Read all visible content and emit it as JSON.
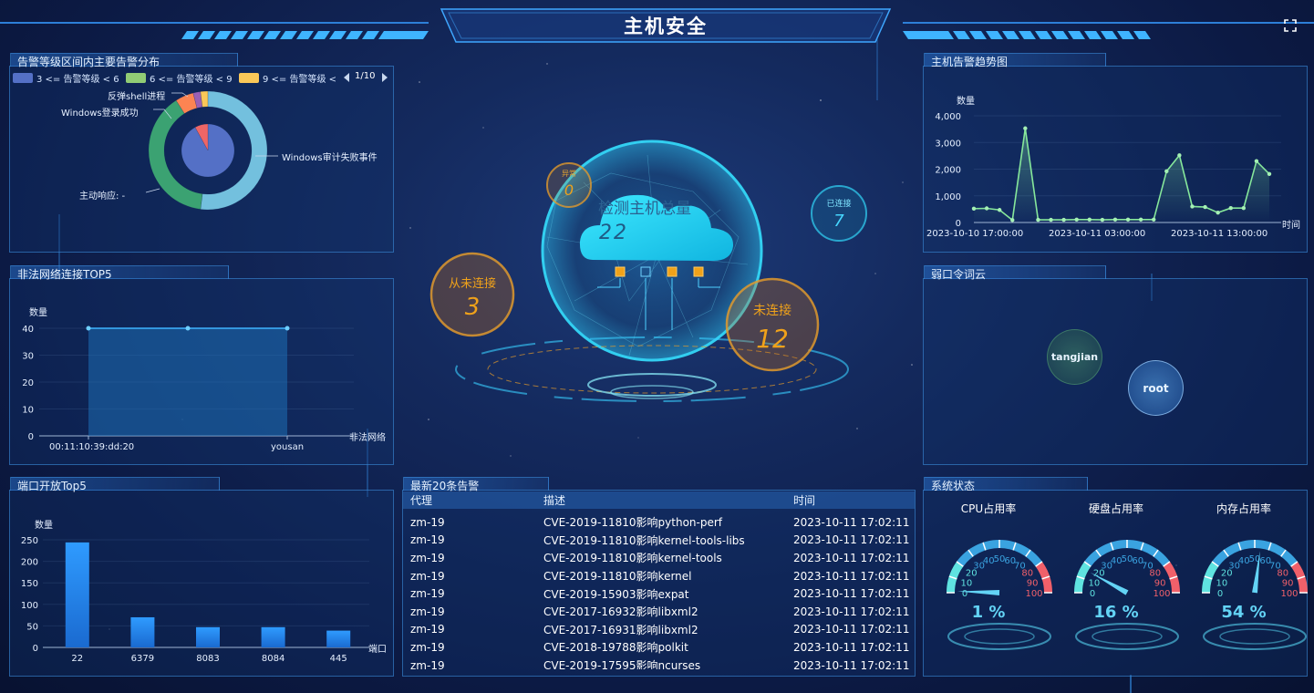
{
  "header": {
    "title": "主机安全",
    "fullscreen_icon": "fullscreen-icon"
  },
  "alarm_dist": {
    "title": "告警等级区间内主要告警分布",
    "legend": [
      {
        "label": "3 <= 告警等级 < 6",
        "color": "#5470c6"
      },
      {
        "label": "6 <= 告警等级 < 9",
        "color": "#91cc75"
      },
      {
        "label": "9 <= 告警等级 <",
        "color": "#fac858"
      }
    ],
    "pager": "1/10",
    "labels": {
      "shell": "反弹shell进程",
      "win_login": "Windows登录成功",
      "win_audit": "Windows审计失败事件",
      "active": "主动响应: -"
    }
  },
  "illegal_conn": {
    "title": "非法网络连接TOP5",
    "y_name": "数量",
    "x_name": "非法网络",
    "x_labels": [
      "00:11:10:39:dd:20",
      "yousan"
    ]
  },
  "port_open": {
    "title": "端口开放Top5",
    "y_name": "数量",
    "x_name": "端口"
  },
  "center": {
    "total_label": "检测主机总量",
    "total_value": "22",
    "abnormal_label": "异常",
    "abnormal_value": "0",
    "connected_label": "已连接",
    "connected_value": "7",
    "never_label": "从未连接",
    "never_value": "3",
    "disconnected_label": "未连接",
    "disconnected_value": "12"
  },
  "trend": {
    "title": "主机告警趋势图",
    "y_name": "数量",
    "x_name": "时间",
    "x_labels": [
      "2023-10-10 17:00:00",
      "2023-10-11 03:00:00",
      "2023-10-11 13:00:00"
    ]
  },
  "weak_pwd": {
    "title": "弱口令词云",
    "words": [
      "tangjian",
      "root"
    ]
  },
  "alerts": {
    "title": "最新20条告警",
    "headers": [
      "代理",
      "描述",
      "时间"
    ],
    "rows": [
      [
        "zm-19",
        "CVE-2019-11810影响python-perf",
        "2023-10-11 17:02:11"
      ],
      [
        "zm-19",
        "CVE-2019-11810影响kernel-tools-libs",
        "2023-10-11 17:02:11"
      ],
      [
        "zm-19",
        "CVE-2019-11810影响kernel-tools",
        "2023-10-11 17:02:11"
      ],
      [
        "zm-19",
        "CVE-2019-11810影响kernel",
        "2023-10-11 17:02:11"
      ],
      [
        "zm-19",
        "CVE-2019-15903影响expat",
        "2023-10-11 17:02:11"
      ],
      [
        "zm-19",
        "CVE-2017-16932影响libxml2",
        "2023-10-11 17:02:11"
      ],
      [
        "zm-19",
        "CVE-2017-16931影响libxml2",
        "2023-10-11 17:02:11"
      ],
      [
        "zm-19",
        "CVE-2018-19788影响polkit",
        "2023-10-11 17:02:11"
      ],
      [
        "zm-19",
        "CVE-2019-17595影响ncurses",
        "2023-10-11 17:02:11"
      ]
    ]
  },
  "system": {
    "title": "系统状态",
    "gauges": [
      {
        "label": "CPU占用率",
        "value": 1,
        "display": "1 %"
      },
      {
        "label": "硬盘占用率",
        "value": 16,
        "display": "16 %"
      },
      {
        "label": "内存占用率",
        "value": 54,
        "display": "54 %"
      }
    ],
    "ticks": [
      "0",
      "10",
      "20",
      "30",
      "40",
      "50",
      "60",
      "70",
      "80",
      "90",
      "100"
    ]
  },
  "chart_data": [
    {
      "type": "pie",
      "title": "告警等级区间内主要告警分布",
      "series": [
        {
          "name": "inner",
          "values": [
            {
              "label": "",
              "value": 92,
              "color": "#5470c6"
            },
            {
              "label": "",
              "value": 8,
              "color": "#ee6666"
            }
          ]
        },
        {
          "name": "outer",
          "values": [
            {
              "label": "Windows审计失败事件",
              "value": 52,
              "color": "#73c0de"
            },
            {
              "label": "主动响应",
              "value": 39,
              "color": "#3ba272"
            },
            {
              "label": "Windows登录成功",
              "value": 5,
              "color": "#fc8452"
            },
            {
              "label": "反弹shell进程",
              "value": 2,
              "color": "#9a60b4"
            },
            {
              "label": "",
              "value": 2,
              "color": "#fac858"
            }
          ]
        }
      ]
    },
    {
      "type": "area",
      "title": "非法网络连接TOP5",
      "categories": [
        "00:11:10:39:dd:20",
        "",
        "yousan"
      ],
      "values": [
        40,
        40,
        40
      ],
      "ylim": [
        0,
        40
      ],
      "yticks": [
        0,
        10,
        20,
        30,
        40
      ],
      "xlabel": "非法网络",
      "ylabel": "数量"
    },
    {
      "type": "bar",
      "title": "端口开放Top5",
      "categories": [
        "22",
        "6379",
        "8083",
        "8084",
        "445"
      ],
      "values": [
        244,
        70,
        47,
        47,
        39
      ],
      "ylim": [
        0,
        250
      ],
      "yticks": [
        0,
        50,
        100,
        150,
        200,
        250
      ],
      "xlabel": "端口",
      "ylabel": "数量"
    },
    {
      "type": "line",
      "title": "主机告警趋势图",
      "x": [
        "2023-10-10 17:00:00",
        "",
        "",
        "",
        "",
        "",
        "",
        "",
        "",
        "",
        "2023-10-11 03:00:00",
        "",
        "",
        "",
        "",
        "",
        "",
        "",
        "",
        "",
        "2023-10-11 13:00:00",
        "",
        "",
        ""
      ],
      "values": [
        520,
        530,
        470,
        90,
        3530,
        100,
        100,
        100,
        110,
        110,
        100,
        110,
        110,
        110,
        110,
        1920,
        2520,
        600,
        580,
        370,
        540,
        540,
        2300,
        1820
      ],
      "ylim": [
        0,
        4000
      ],
      "yticks": [
        0,
        1000,
        2000,
        3000,
        4000
      ],
      "ytick_labels": [
        "0",
        "1,000",
        "2,000",
        "3,000",
        "4,000"
      ],
      "xlabel": "时间",
      "ylabel": "数量"
    }
  ]
}
